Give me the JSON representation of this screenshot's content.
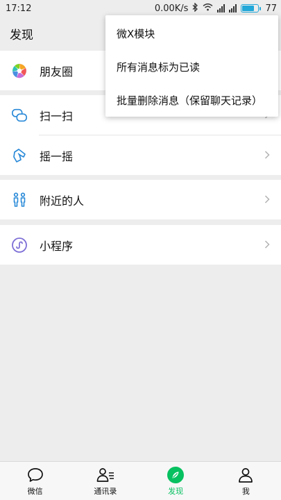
{
  "status_bar": {
    "time": "17:12",
    "net_speed": "0.00K/s",
    "battery": "77",
    "battery_level_fraction": 0.77
  },
  "header": {
    "title": "发现"
  },
  "list": {
    "moments": "朋友圈",
    "scan": "扫一扫",
    "shake": "摇一摇",
    "nearby": "附近的人",
    "miniprogram": "小程序"
  },
  "menu": {
    "items": [
      "微X模块",
      "所有消息标为已读",
      "批量删除消息（保留聊天记录）"
    ]
  },
  "tabbar": {
    "tabs": [
      "微信",
      "通讯录",
      "发现",
      "我"
    ],
    "active_index": 2
  },
  "colors": {
    "accent_green": "#07c160",
    "icon_blue": "#2a8ad8",
    "background": "#ededed"
  },
  "icons": [
    "bluetooth-icon",
    "wifi-icon",
    "signal-icon",
    "battery-icon",
    "moments-icon",
    "scan-icon",
    "shake-icon",
    "nearby-icon",
    "miniprogram-icon",
    "chevron-right-icon",
    "chat-icon",
    "contacts-icon",
    "discover-icon",
    "me-icon"
  ]
}
